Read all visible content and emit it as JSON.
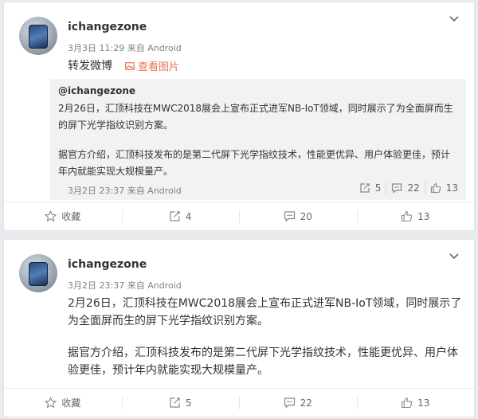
{
  "post1": {
    "username": "ichangezone",
    "timestamp": "3月3日 11:29",
    "source": "来自 Android",
    "text": "转发微博",
    "view_image": "查看图片",
    "quoted": {
      "username": "@ichangezone",
      "paragraph1": "2月26日，汇顶科技在MWC2018展会上宣布正式进军NB-IoT领域，同时展示了为全面屏而生的屏下光学指纹识别方案。",
      "paragraph2": "据官方介绍，汇顶科技发布的是第二代屏下光学指纹技术，性能更优异、用户体验更佳，预计年内就能实现大规模量产。",
      "meta": "3月2日 23:37 来自 Android",
      "reposts": "5",
      "comments": "22",
      "likes": "13"
    },
    "footer": {
      "favorite": "收藏",
      "reposts": "4",
      "comments": "20",
      "likes": "13"
    }
  },
  "post2": {
    "username": "ichangezone",
    "timestamp": "3月2日 23:37",
    "source": "来自 Android",
    "paragraph1": "2月26日，汇顶科技在MWC2018展会上宣布正式进军NB-IoT领域，同时展示了为全面屏而生的屏下光学指纹识别方案。",
    "paragraph2": "据官方介绍，汇顶科技发布的是第二代屏下光学指纹技术，性能更优异、用户体验更佳，预计年内就能实现大规模量产。",
    "footer": {
      "favorite": "收藏",
      "reposts": "5",
      "comments": "22",
      "likes": "13"
    }
  },
  "colors": {
    "accent": "#eb7350",
    "quote_bg": "#f2f2f5",
    "meta_text": "#808080"
  },
  "icons": [
    "chevron-down-icon",
    "image-icon",
    "star-icon",
    "repost-icon",
    "comment-icon",
    "like-icon"
  ]
}
